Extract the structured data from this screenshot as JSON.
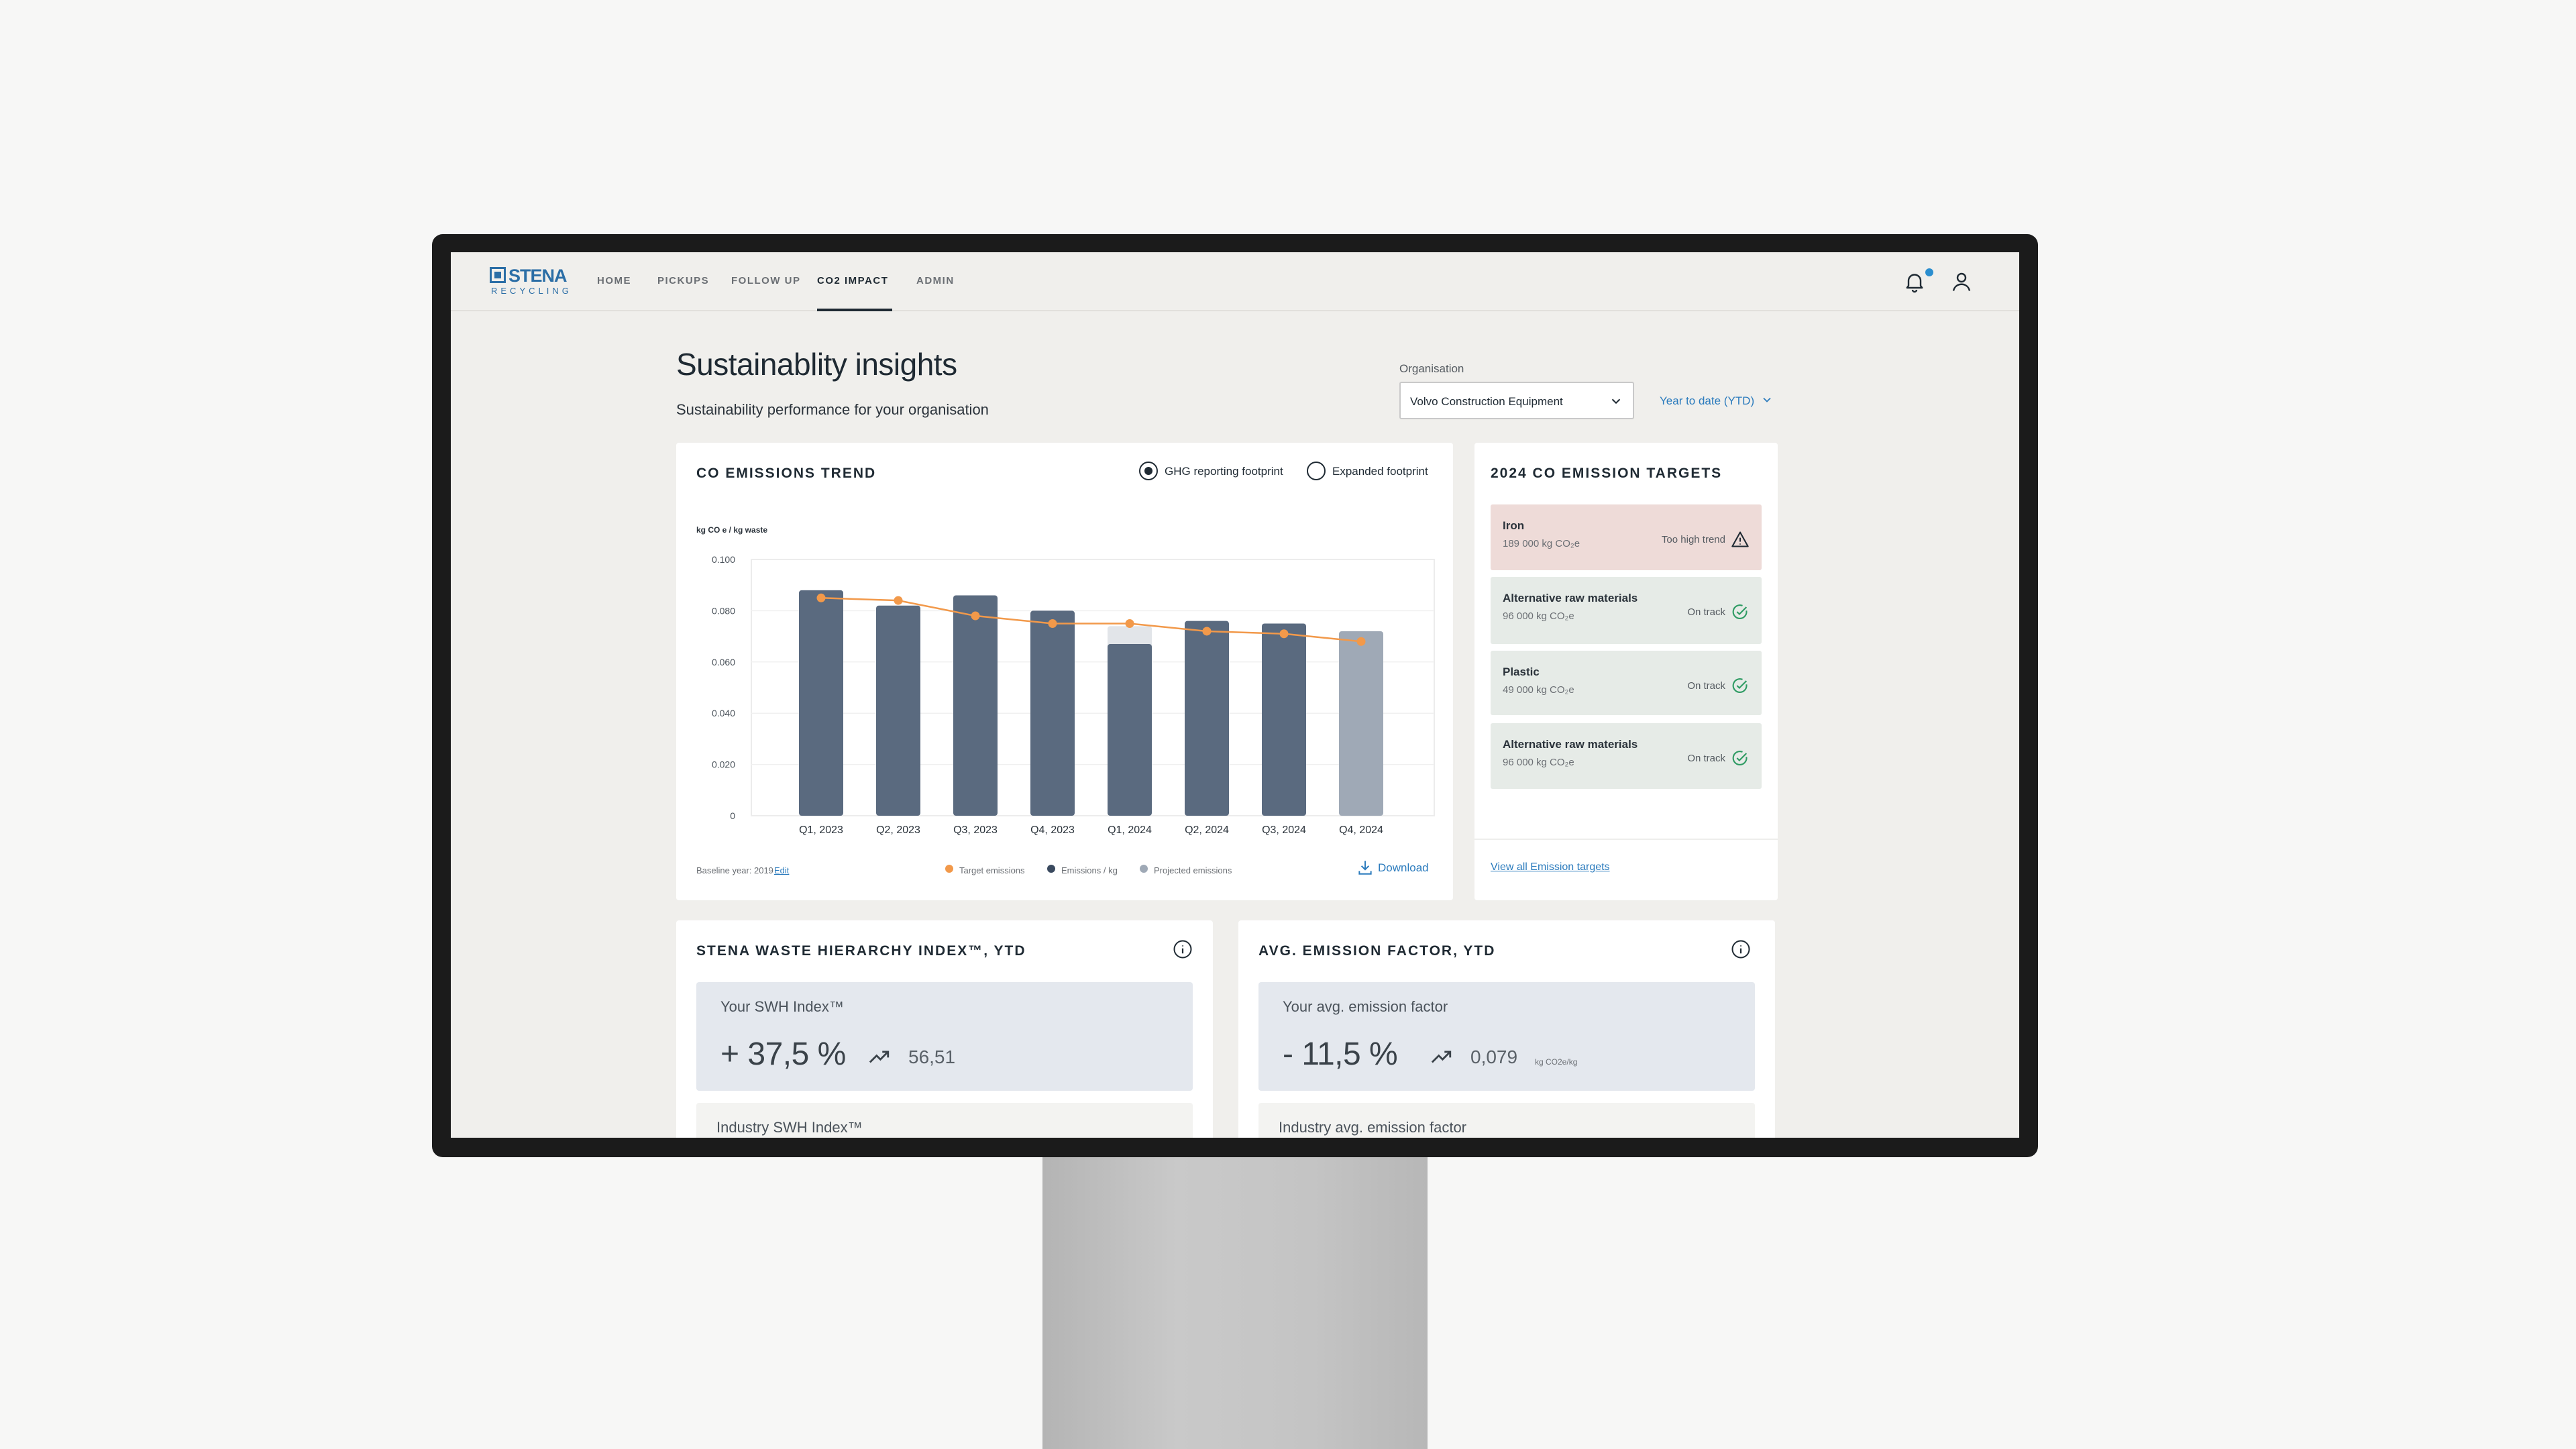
{
  "nav": {
    "logo_name": "STENA",
    "logo_sub": "RECYCLING",
    "items": [
      {
        "label": "HOME",
        "active": false
      },
      {
        "label": "PICKUPS",
        "active": false
      },
      {
        "label": "FOLLOW UP",
        "active": false
      },
      {
        "label": "CO2 IMPACT",
        "active": true
      },
      {
        "label": "ADMIN",
        "active": false
      }
    ]
  },
  "header": {
    "title": "Sustainablity insights",
    "subtitle": "Sustainability performance for your organisation",
    "org_label": "Organisation",
    "org_value": "Volvo Construction Equipment",
    "period": "Year to date (YTD)"
  },
  "trend_card": {
    "title": "CO  EMISSIONS TREND",
    "radio_ghg": "GHG reporting footprint",
    "radio_expanded": "Expanded footprint",
    "radio_selected": "ghg",
    "baseline_text": "Baseline year: 2019",
    "edit_link": "Edit",
    "download": "Download",
    "legend_target": "Target emissions",
    "legend_emissions": "Emissions / kg",
    "legend_projected": "Projected emissions"
  },
  "chart_data": {
    "type": "bar",
    "ylabel": "kg CO e  / kg waste",
    "ylim": [
      0,
      0.1
    ],
    "yticks": [
      "0",
      "0.020",
      "0.040",
      "0.060",
      "0.080",
      "0.100"
    ],
    "ytick_values": [
      0,
      0.02,
      0.04,
      0.06,
      0.08,
      0.1
    ],
    "categories": [
      "Q1, 2023",
      "Q2, 2023",
      "Q3, 2023",
      "Q4, 2023",
      "Q1, 2024",
      "Q2, 2024",
      "Q3, 2024",
      "Q4, 2024"
    ],
    "series": [
      {
        "name": "Emissions / kg",
        "values": [
          0.088,
          0.082,
          0.086,
          0.08,
          0.067,
          0.076,
          0.075,
          null
        ],
        "color": "#5a6a7f"
      },
      {
        "name": "Projected emissions",
        "values": [
          null,
          null,
          null,
          null,
          0.074,
          null,
          null,
          0.072
        ],
        "color": "#9fa9b6"
      },
      {
        "name": "Target emissions",
        "values": [
          0.085,
          0.084,
          0.078,
          0.075,
          0.075,
          0.072,
          0.071,
          0.068
        ],
        "color": "#f2994a"
      }
    ],
    "grid": true
  },
  "targets_card": {
    "title": "2024 CO  EMISSION TARGETS",
    "items": [
      {
        "name": "Iron",
        "value": "189 000 kg CO₂e",
        "status": "Too high trend",
        "state": "warn",
        "bg": "#eedbd8"
      },
      {
        "name": "Alternative raw materials",
        "value": "96 000 kg CO₂e",
        "status": "On track",
        "state": "ok",
        "bg": "#e6ebe7"
      },
      {
        "name": "Plastic",
        "value": "49 000 kg CO₂e",
        "status": "On track",
        "state": "ok",
        "bg": "#e6ebe7"
      },
      {
        "name": "Alternative raw materials",
        "value": "96 000 kg CO₂e",
        "status": "On track",
        "state": "ok",
        "bg": "#e6ebe7"
      }
    ],
    "view_all": "View all Emission targets"
  },
  "swh_card": {
    "title": "STENA WASTE HIERARCHY INDEX™, YTD",
    "your_label": "Your SWH Index™",
    "your_value": "+ 37,5 %",
    "trend_value": "56,51",
    "industry_label": "Industry SWH Index™"
  },
  "factor_card": {
    "title": "AVG. EMISSION FACTOR, YTD",
    "your_label": "Your avg. emission factor",
    "your_value": "- 11,5 %",
    "trend_value": "0,079",
    "unit": "kg CO2e/kg",
    "industry_label": "Industry avg. emission factor"
  },
  "colors": {
    "accent": "#2b7bbd",
    "bar": "#5a6a7f",
    "projected": "#9fa9b6",
    "target": "#f2994a",
    "ok": "#2e9b63",
    "warn": "#1f2a33"
  }
}
